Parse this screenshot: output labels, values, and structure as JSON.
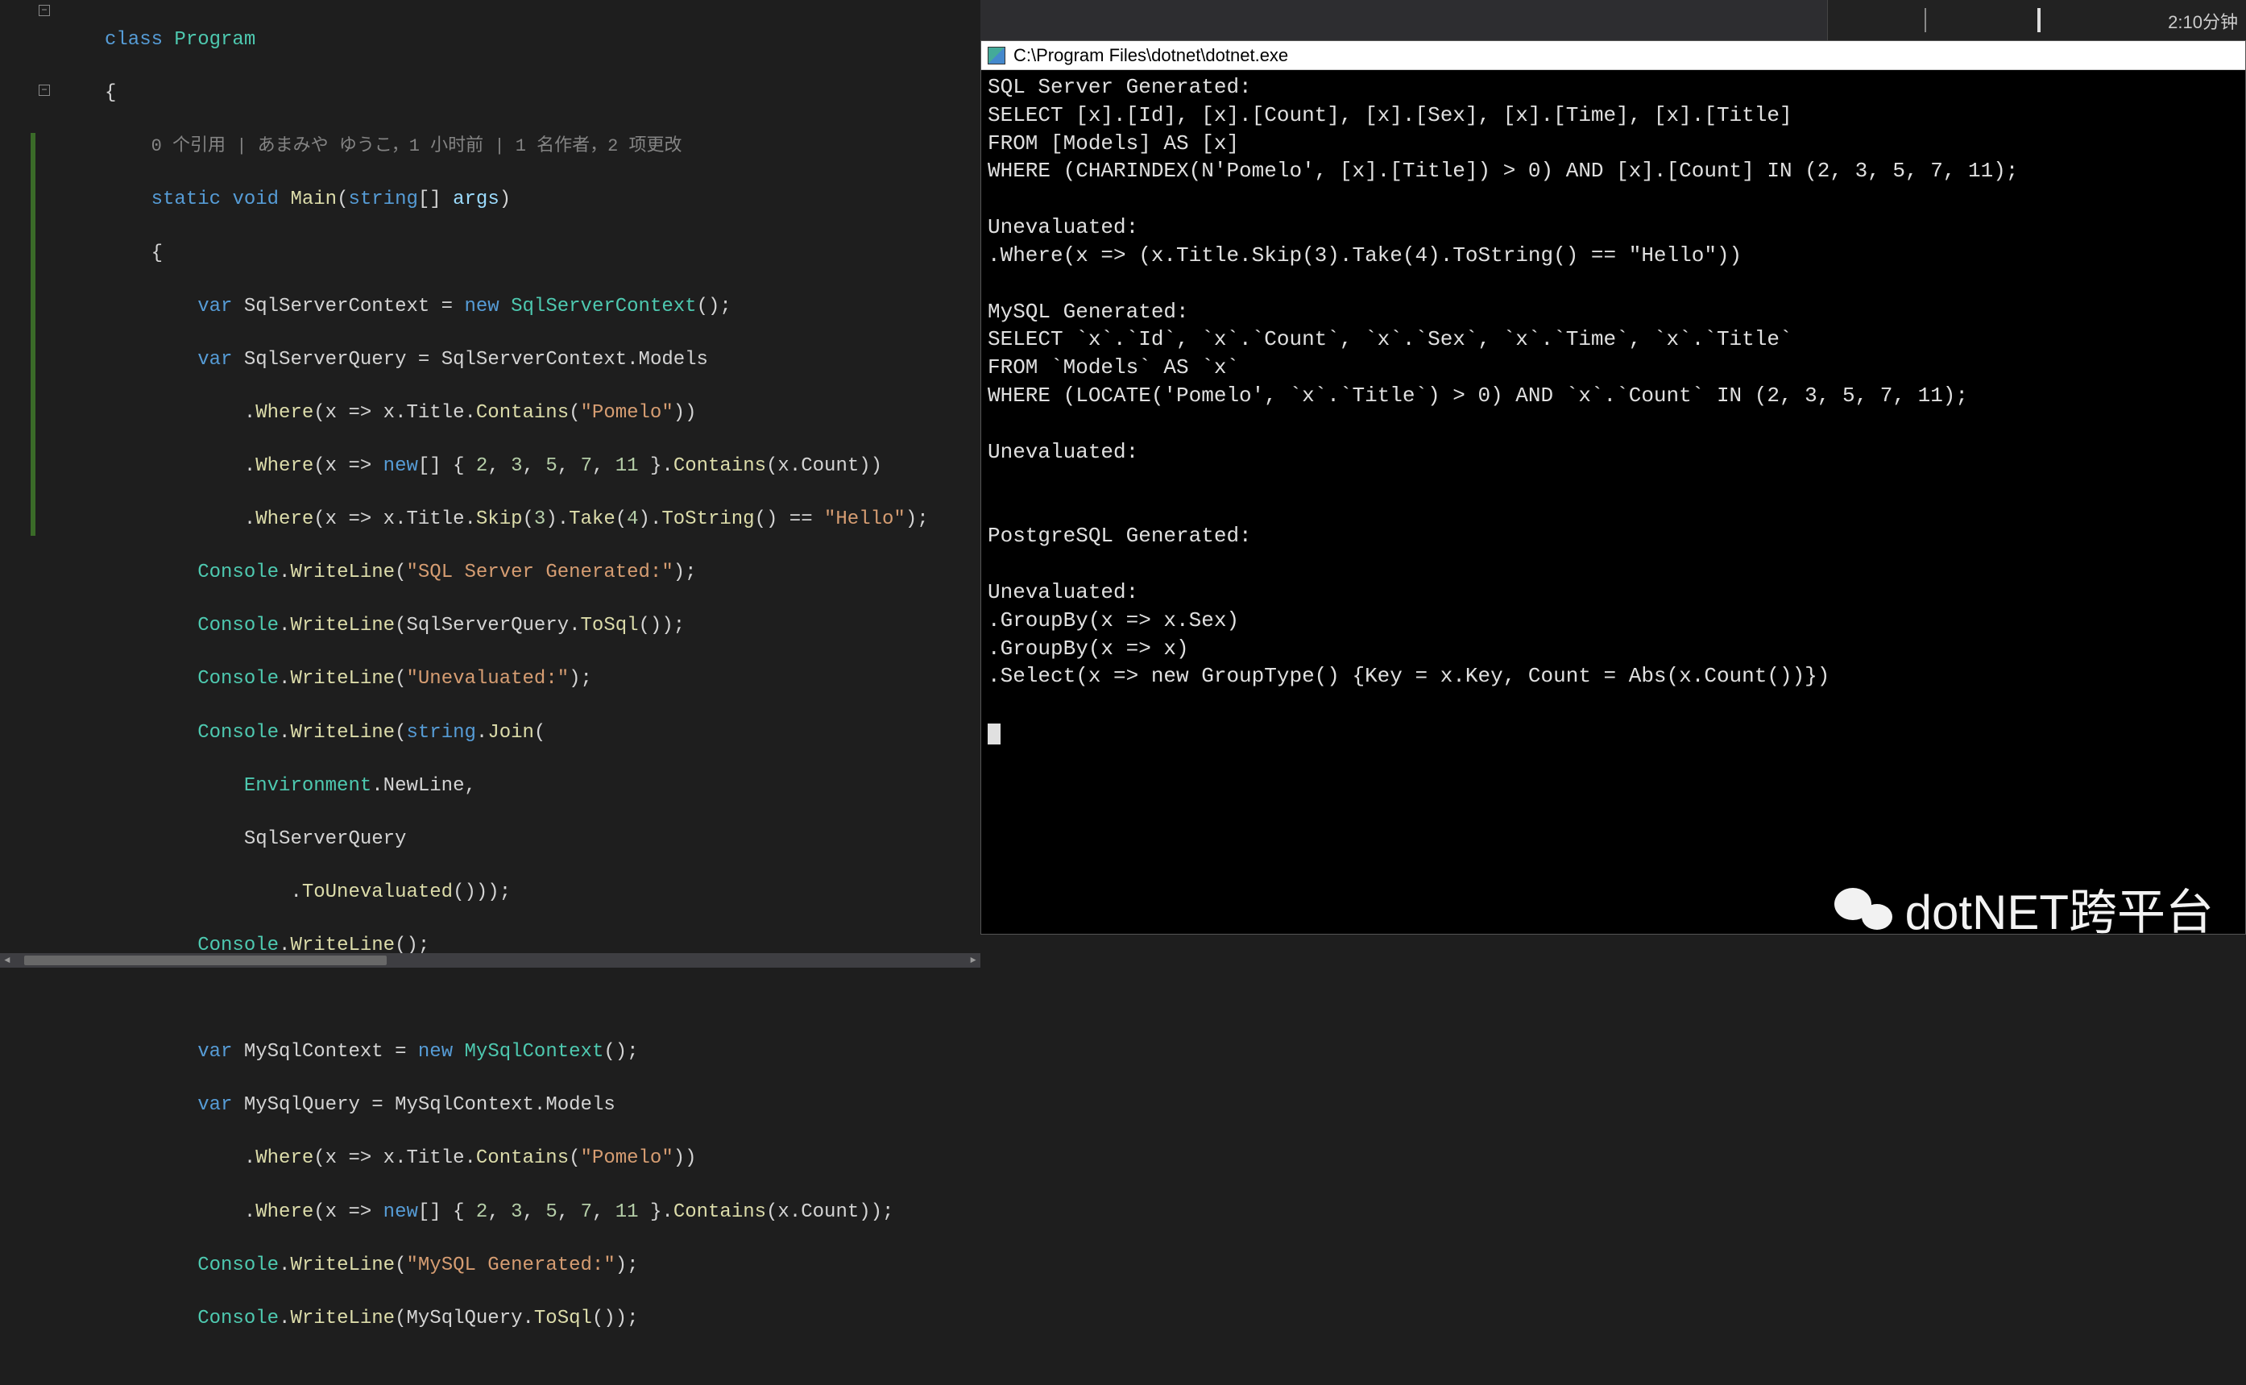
{
  "timeline": {
    "label": "2:10分钟"
  },
  "editor": {
    "codelens": "0 个引用 | あまみや ゆうこ，1 小时前 | 1 名作者，2 项更改",
    "tokens": {
      "class": "class",
      "program": "Program",
      "static": "static",
      "void": "void",
      "main": "Main",
      "string": "string",
      "args": "args",
      "var": "var",
      "new": "new",
      "sscVar": "SqlServerContext",
      "sscType": "SqlServerContext",
      "ssqVar": "SqlServerQuery",
      "models": "Models",
      "where": "Where",
      "x": "x",
      "title": "Title",
      "contains": "Contains",
      "pomelo": "\"Pomelo\"",
      "arr": "{ 2, 3, 5, 7, 11 }",
      "count": "Count",
      "skip": "Skip",
      "take": "Take",
      "tostring": "ToString",
      "hello": "\"Hello\"",
      "console": "Console",
      "writeline": "WriteLine",
      "sqlgen": "\"SQL Server Generated:\"",
      "tosql": "ToSql",
      "uneval": "\"Unevaluated:\"",
      "join": "Join",
      "env": "Environment",
      "newline": "NewLine",
      "touneval": "ToUnevaluated",
      "mysqlctxVar": "MySqlContext",
      "mysqlctxType": "MySqlContext",
      "mysqlQ": "MySqlQuery",
      "mysqlgen": "\"MySQL Generated:\"",
      "n2": "2",
      "n3": "3",
      "n4": "4",
      "n5": "5",
      "n7": "7",
      "n11": "11"
    }
  },
  "console": {
    "title": "C:\\Program Files\\dotnet\\dotnet.exe",
    "lines": [
      "SQL Server Generated:",
      "SELECT [x].[Id], [x].[Count], [x].[Sex], [x].[Time], [x].[Title]",
      "FROM [Models] AS [x]",
      "WHERE (CHARINDEX(N'Pomelo', [x].[Title]) > 0) AND [x].[Count] IN (2, 3, 5, 7, 11);",
      "",
      "Unevaluated:",
      ".Where(x => (x.Title.Skip(3).Take(4).ToString() == \"Hello\"))",
      "",
      "MySQL Generated:",
      "SELECT `x`.`Id`, `x`.`Count`, `x`.`Sex`, `x`.`Time`, `x`.`Title`",
      "FROM `Models` AS `x`",
      "WHERE (LOCATE('Pomelo', `x`.`Title`) > 0) AND `x`.`Count` IN (2, 3, 5, 7, 11);",
      "",
      "Unevaluated:",
      "",
      "",
      "PostgreSQL Generated:",
      "",
      "Unevaluated:",
      ".GroupBy(x => x.Sex)",
      ".GroupBy(x => x)",
      ".Select(x => new GroupType() {Key = x.Key, Count = Abs(x.Count())})"
    ]
  },
  "watermark": "dotNET跨平台"
}
